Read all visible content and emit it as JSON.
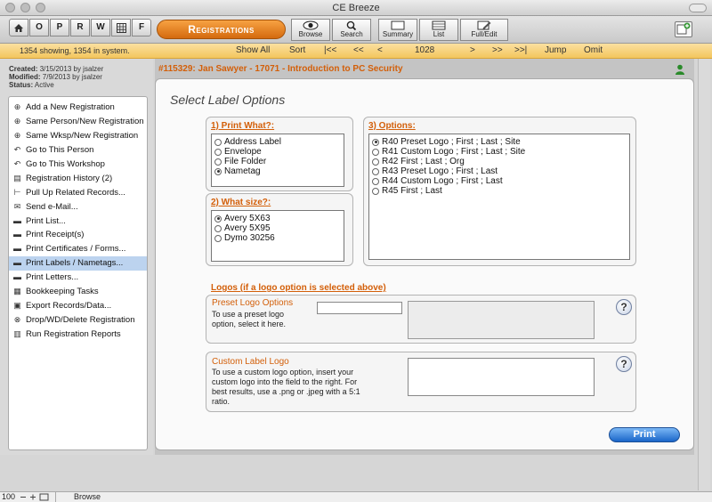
{
  "window": {
    "title": "CE Breeze"
  },
  "toolbar": {
    "nav_buttons": [
      "O",
      "P",
      "R",
      "W",
      "F"
    ],
    "home_icon": "home-icon",
    "grid_icon": "calculator-icon",
    "section_tab": "Registrations",
    "view_buttons": [
      {
        "label": "Browse",
        "icon": "eye-icon"
      },
      {
        "label": "Search",
        "icon": "magnifier-icon"
      },
      {
        "label": "Summary",
        "icon": "summary-icon"
      },
      {
        "label": "List",
        "icon": "list-icon"
      },
      {
        "label": "Full/Edit",
        "icon": "edit-icon"
      }
    ]
  },
  "status": {
    "count": "1354 showing, 1354 in system.",
    "show_all": "Show All",
    "sort": "Sort",
    "first": "|<<",
    "prev_many": "<<",
    "prev": "<",
    "record": "1028",
    "next": ">",
    "next_many": ">>",
    "last": ">>|",
    "jump": "Jump",
    "omit": "Omit"
  },
  "meta": {
    "created_label": "Created:",
    "created_value": "3/15/2013 by jsalzer",
    "modified_label": "Modified:",
    "modified_value": "7/9/2013 by jsalzer",
    "status_label": "Status:",
    "status_value": "Active"
  },
  "menu": [
    {
      "label": "Add a New Registration",
      "icon": "plus-circle-icon"
    },
    {
      "label": "Same Person/New Registration",
      "icon": "plus-circle-icon"
    },
    {
      "label": "Same Wksp/New Registration",
      "icon": "plus-circle-icon"
    },
    {
      "label": "Go to This Person",
      "icon": "back-arrow-icon"
    },
    {
      "label": "Go to This Workshop",
      "icon": "back-arrow-icon"
    },
    {
      "label": "Registration History (2)",
      "icon": "history-icon"
    },
    {
      "label": "Pull Up Related Records...",
      "icon": "tree-icon"
    },
    {
      "label": "Send e-Mail...",
      "icon": "envelope-icon"
    },
    {
      "label": "Print List...",
      "icon": "printer-icon"
    },
    {
      "label": "Print Receipt(s)",
      "icon": "printer-icon"
    },
    {
      "label": "Print Certificates / Forms...",
      "icon": "printer-icon"
    },
    {
      "label": "Print Labels / Nametags...",
      "icon": "printer-icon",
      "selected": true
    },
    {
      "label": "Print Letters...",
      "icon": "printer-icon"
    },
    {
      "label": "Bookkeeping Tasks",
      "icon": "ledger-icon"
    },
    {
      "label": "Export Records/Data...",
      "icon": "export-icon"
    },
    {
      "label": "Drop/WD/Delete Registration",
      "icon": "x-circle-icon"
    },
    {
      "label": "Run Registration Reports",
      "icon": "bar-chart-icon"
    }
  ],
  "record": {
    "title": "#115329:  Jan Sawyer - 17071 - Introduction to PC Security"
  },
  "form": {
    "heading": "Select Label Options",
    "print_what": {
      "label": "1)  Print What?:",
      "options": [
        "Address Label",
        "Envelope",
        "File Folder",
        "Nametag"
      ],
      "selected": 3
    },
    "what_size": {
      "label": "2)  What size?:",
      "options": [
        "Avery 5X63",
        "Avery 5X95",
        "Dymo 30256"
      ],
      "selected": 0
    },
    "options": {
      "label": "3)  Options:",
      "options": [
        "R40 Preset Logo ; First ; Last ; Site",
        "R41 Custom Logo ; First ; Last ; Site",
        "R42 First ; Last ; Org",
        "R43 Preset Logo ; First ; Last",
        "R44 Custom Logo ; First ; Last",
        "R45 First ; Last"
      ],
      "selected": 0
    },
    "logos": {
      "label": "Logos (if a logo option is selected above)",
      "preset_title": "Preset Logo Options",
      "preset_desc_1": "To use a preset logo",
      "preset_desc_2": "option, select it here.",
      "preset_value": "",
      "custom_title": "Custom Label Logo",
      "custom_desc_1": "To use a custom logo option, insert your",
      "custom_desc_2": "custom logo into the field to the right.  For",
      "custom_desc_3": "best results, use a .png or .jpeg with a 5:1",
      "custom_desc_4": "ratio."
    },
    "help_glyph": "?",
    "print_button": "Print"
  },
  "footer": {
    "zoom": "100",
    "mode": "Browse"
  },
  "colors": {
    "accent": "#d35f09",
    "tab": "#e9841f",
    "status_bar": "#f5cf72",
    "print_button": "#2a74d6"
  }
}
